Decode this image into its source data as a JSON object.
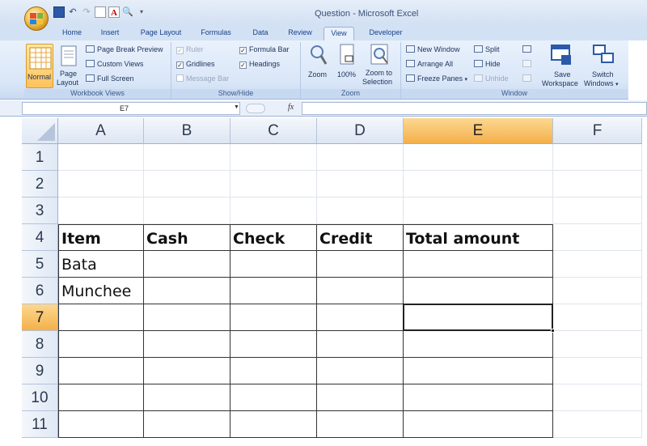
{
  "window": {
    "title": "Question - Microsoft Excel"
  },
  "qat": {
    "separator": "▾"
  },
  "tabs": [
    {
      "label": "Home"
    },
    {
      "label": "Insert"
    },
    {
      "label": "Page Layout"
    },
    {
      "label": "Formulas"
    },
    {
      "label": "Data"
    },
    {
      "label": "Review"
    },
    {
      "label": "View",
      "active": true
    },
    {
      "label": "Developer"
    }
  ],
  "ribbon": {
    "workbook_views": {
      "label": "Workbook Views",
      "normal": "Normal",
      "page_layout_1": "Page",
      "page_layout_2": "Layout",
      "page_break_preview": "Page Break Preview",
      "custom_views": "Custom Views",
      "full_screen": "Full Screen"
    },
    "show_hide": {
      "label": "Show/Hide",
      "ruler": "Ruler",
      "gridlines": "Gridlines",
      "message_bar": "Message Bar",
      "formula_bar": "Formula Bar",
      "headings": "Headings",
      "check_mark": "✓"
    },
    "zoom": {
      "label": "Zoom",
      "zoom": "Zoom",
      "hundred": "100%",
      "zoom_to_1": "Zoom to",
      "zoom_to_2": "Selection"
    },
    "window": {
      "label": "Window",
      "new_window": "New Window",
      "arrange_all": "Arrange All",
      "freeze_panes": "Freeze Panes",
      "freeze_arrow": "▾",
      "split": "Split",
      "hide": "Hide",
      "unhide": "Unhide",
      "save_1": "Save",
      "save_2": "Workspace",
      "switch_1": "Switch",
      "switch_2": "Windows",
      "switch_arrow": "▾"
    }
  },
  "formula_bar": {
    "name_box": "E7",
    "name_arrow": "▼",
    "fx": "fx",
    "value": ""
  },
  "sheet": {
    "columns": [
      "A",
      "B",
      "C",
      "D",
      "E",
      "F"
    ],
    "rows": [
      "1",
      "2",
      "3",
      "4",
      "5",
      "6",
      "7",
      "8",
      "9",
      "10",
      "11"
    ],
    "selected_column": "E",
    "selected_row": "7",
    "active_cell": "E7",
    "cells": {
      "A4": "Item",
      "B4": "Cash",
      "C4": "Check",
      "D4": "Credit",
      "E4": "Total amount",
      "A5": "Bata",
      "A6": "Munchee"
    }
  },
  "colors": {
    "selection_header": "#f4b04a",
    "ribbon": "#dae7f8",
    "tab_text": "#15428b"
  }
}
